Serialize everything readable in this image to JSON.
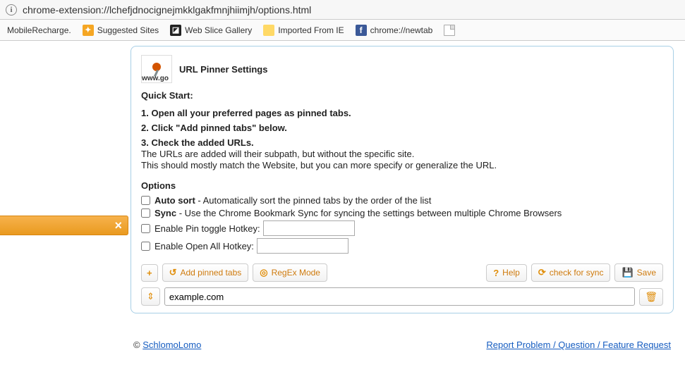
{
  "address_bar": {
    "url": "chrome-extension://lchefjdnocignejmkklgakfmnjhiimjh/options.html"
  },
  "bookmarks": [
    {
      "label": "MobileRecharge.",
      "icon": ""
    },
    {
      "label": "Suggested Sites",
      "icon": "orange"
    },
    {
      "label": "Web Slice Gallery",
      "icon": "dark"
    },
    {
      "label": "Imported From IE",
      "icon": "yellow"
    },
    {
      "label": "chrome://newtab",
      "icon": "fb"
    },
    {
      "label": "",
      "icon": "doc"
    }
  ],
  "side_stub": {
    "close": "×"
  },
  "panel": {
    "logo_text": "www.go",
    "title": "URL Pinner Settings",
    "quick_start_heading": "Quick Start:",
    "steps": [
      {
        "num": "1.",
        "bold": "Open all your preferred pages as pinned tabs.",
        "rest": ""
      },
      {
        "num": "2.",
        "bold": "Click \"Add pinned tabs\" below.",
        "rest": ""
      },
      {
        "num": "3.",
        "bold": "Check the added URLs.",
        "rest": ""
      }
    ],
    "notes": [
      "The URLs are added will their subpath, but without the specific site.",
      "This should mostly match the Website, but you can more specify or generalize the URL."
    ],
    "options_heading": "Options",
    "opt_autosort": {
      "bold": "Auto sort",
      "desc": " - Automatically sort the pinned tabs by the order of the list"
    },
    "opt_sync": {
      "bold": "Sync",
      "desc": " - Use the Chrome Bookmark Sync for syncing the settings between multiple Chrome Browsers"
    },
    "opt_hotkey_pin_label": "Enable Pin toggle Hotkey:",
    "opt_hotkey_pin_value": "",
    "opt_hotkey_open_label": "Enable Open All Hotkey:",
    "opt_hotkey_open_value": "",
    "buttons": {
      "add": "+",
      "add_pinned": "Add pinned tabs",
      "regex": "RegEx Mode",
      "help": "Help",
      "check_sync": "check for sync",
      "save": "Save"
    },
    "url_entry": {
      "value": "example.com",
      "drag": "⇕",
      "delete": "🗑"
    }
  },
  "footer": {
    "copyright": "© ",
    "author": "SchlomoLomo",
    "report": "Report Problem / Question / Feature Request"
  }
}
